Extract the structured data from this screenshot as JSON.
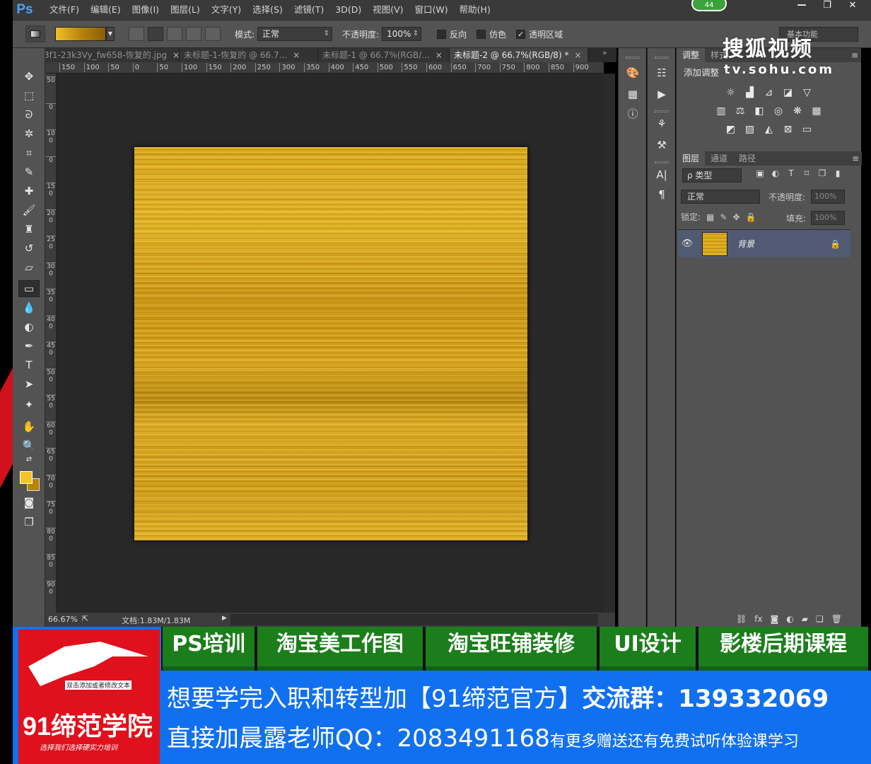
{
  "app": {
    "logo": "Ps",
    "badge": "44"
  },
  "menu": [
    "文件(F)",
    "编辑(E)",
    "图像(I)",
    "图层(L)",
    "文字(Y)",
    "选择(S)",
    "滤镜(T)",
    "3D(D)",
    "视图(V)",
    "窗口(W)",
    "帮助(H)"
  ],
  "window_buttons": {
    "minimize": "—",
    "restore": "❐",
    "close": "✕"
  },
  "options": {
    "mode_label": "模式:",
    "mode_value": "正常",
    "opacity_label": "不透明度:",
    "opacity_value": "100%",
    "reverse_label": "反向",
    "dither_label": "仿色",
    "transparency_label": "透明区域",
    "reverse_checked": false,
    "dither_checked": false,
    "transparency_checked": true,
    "workspace": "基本功能",
    "gradient_colors": [
      "#f2c028",
      "#b8860b",
      "#8a5c08"
    ]
  },
  "tabs": [
    {
      "label": "3f1-23k3Vy_fw658-恢复的.jpg",
      "active": false
    },
    {
      "label": "未标题-1-恢复的 @ 66.7...",
      "active": false
    },
    {
      "label": "未标题-1 @ 66.7%(RGB/...",
      "active": false
    },
    {
      "label": "未标题-2 @ 66.7%(RGB/8) *",
      "active": true
    }
  ],
  "ruler": {
    "top": [
      "150",
      "100",
      "50",
      "0",
      "50",
      "100",
      "150",
      "200",
      "250",
      "300",
      "350",
      "400",
      "450",
      "500",
      "550",
      "600",
      "650",
      "700",
      "750",
      "800",
      "850",
      "900"
    ],
    "left": [
      "50",
      "0",
      "100",
      "0",
      "150",
      "200",
      "250",
      "300",
      "350",
      "400",
      "450",
      "500",
      "550",
      "600",
      "650",
      "700",
      "750",
      "800",
      "850",
      "900"
    ]
  },
  "status": {
    "zoom": "66.67%",
    "doc": "文档:1.83M/1.83M"
  },
  "panels": {
    "adjust_tabs": [
      "调整",
      "样式"
    ],
    "adjust_title": "添加调整",
    "layer_tabs": [
      "图层",
      "通道",
      "路径"
    ],
    "layer_filter": "ρ 类型",
    "blend_mode": "正常",
    "opacity_label": "不透明度:",
    "opacity_value": "100%",
    "lock_label": "锁定:",
    "fill_label": "填充:",
    "fill_value": "100%",
    "layer_name": "背景"
  },
  "watermark": {
    "brand": "搜狐视频",
    "url": "tv.sohu.com"
  },
  "banner": {
    "logo_small": "双击添加或者修改文本",
    "logo_main": "91缔范学院",
    "logo_slogan": "选择我们选择硬实力培训",
    "courses": [
      "PS培训",
      "淘宝美工作图",
      "淘宝旺铺装修",
      "UI设计",
      "影楼后期课程"
    ],
    "line1_a": "想要学完入职和转型加【91缔范官方】",
    "line1_b": "交流群：139332069",
    "line2_a": "直接加晨露老师QQ：2083491168",
    "line2_b": "有更多赠送还有免费试听体验课学习"
  },
  "colors": {
    "foreground": "#f3c42a",
    "background": "#b8840a",
    "accent_blue": "#1170f0",
    "accent_green": "#1b7e1b",
    "accent_red": "#e0101c"
  }
}
